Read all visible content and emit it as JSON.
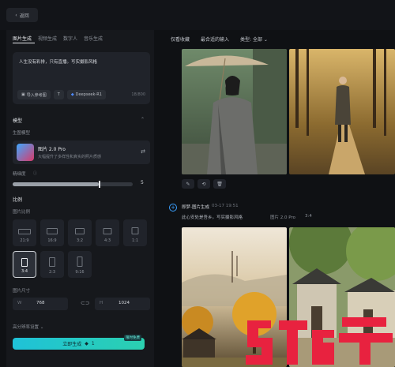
{
  "topbar": {
    "back_label": "返回"
  },
  "left": {
    "tabs": [
      "图片生成",
      "视频生成",
      "数字人",
      "音乐生成"
    ],
    "prompt": {
      "text": "人生没有彩排，只有直播。写实摄影风格",
      "import_label": "导入参考图",
      "model_chip": "Deepseek-R1",
      "count": "18/800"
    },
    "model_section": "模型",
    "model_sub": "生图模型",
    "model_name": "图片 2.0 Pro",
    "model_desc": "大幅提升了多样性和真实的照片质感",
    "strength_label": "精细度",
    "strength_value": "5",
    "strength_fraction": 0.72,
    "ratio_section": "比例",
    "ratio_sub": "图片比例",
    "ratios": [
      "21:9",
      "16:9",
      "3:2",
      "4:3",
      "1:1",
      "3:4",
      "2:3",
      "9:16"
    ],
    "selected_ratio": "3:4",
    "size_label": "图片尺寸",
    "width_key": "W",
    "width_value": "768",
    "height_key": "H",
    "height_value": "1024",
    "resolution_label": "高分辨率设置",
    "generate_label": "立即生成",
    "generate_cost": "1",
    "generate_badge": "限时免费"
  },
  "right": {
    "tabs": [
      "仅看收藏",
      "最合适的输入",
      "类型: 全部"
    ],
    "post_title": "即梦-图片生成",
    "post_date": "03-17 19:51",
    "post_desc": "此心安处是吾乡。写实摄影风格",
    "post_model": "图片 2.0 Pro",
    "post_ratio": "3:4"
  },
  "colors": {
    "accent": "#1fc2d8",
    "panel": "#16181c",
    "background": "#0f1114"
  }
}
